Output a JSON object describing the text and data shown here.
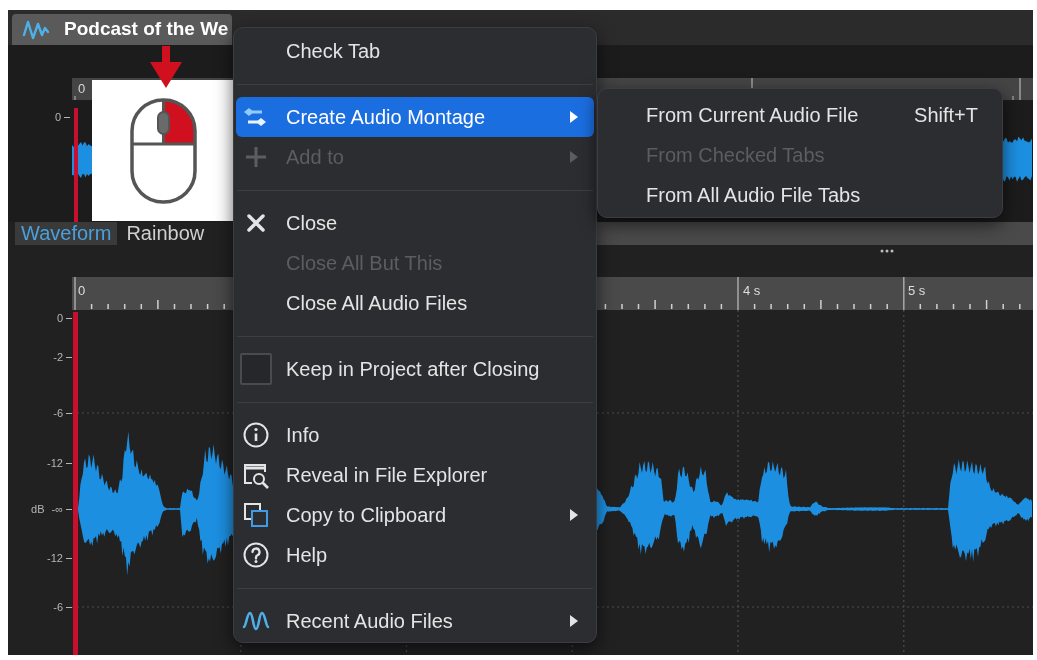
{
  "file_tabs": [
    {
      "title": "Podcast of the We",
      "selected": true
    }
  ],
  "overview": {
    "ruler_labels": [
      "0"
    ],
    "db_labels": [
      "0"
    ]
  },
  "view_tabs": [
    {
      "label": "Waveform",
      "selected": true
    },
    {
      "label": "Rainbow",
      "selected": false
    }
  ],
  "waveform_panel": {
    "ruler_labels": [
      "0",
      "4 s",
      "5 s"
    ],
    "db_unit": "dB",
    "db_labels": [
      "0",
      "-2",
      "-6",
      "-12",
      "-∞",
      "-12",
      "-6"
    ]
  },
  "context_menu": {
    "items": [
      {
        "kind": "item",
        "label": "Check Tab",
        "highlighted": false,
        "disabled": false,
        "has_submenu": false
      },
      {
        "kind": "separator"
      },
      {
        "kind": "item",
        "label": "Create Audio Montage",
        "highlighted": true,
        "disabled": false,
        "has_submenu": true
      },
      {
        "kind": "item",
        "label": "Add to",
        "highlighted": false,
        "disabled": true,
        "has_submenu": true
      },
      {
        "kind": "separator"
      },
      {
        "kind": "item",
        "label": "Close",
        "highlighted": false,
        "disabled": false,
        "has_submenu": false
      },
      {
        "kind": "item",
        "label": "Close All But This",
        "highlighted": false,
        "disabled": true,
        "has_submenu": false
      },
      {
        "kind": "item",
        "label": "Close All Audio Files",
        "highlighted": false,
        "disabled": false,
        "has_submenu": false
      },
      {
        "kind": "separator"
      },
      {
        "kind": "checkbox",
        "label": "Keep in Project after Closing",
        "checked": false,
        "highlighted": false,
        "disabled": false
      },
      {
        "kind": "separator"
      },
      {
        "kind": "item",
        "label": "Info",
        "highlighted": false,
        "disabled": false,
        "has_submenu": false
      },
      {
        "kind": "item",
        "label": "Reveal in File Explorer",
        "highlighted": false,
        "disabled": false,
        "has_submenu": false
      },
      {
        "kind": "item",
        "label": "Copy to Clipboard",
        "highlighted": false,
        "disabled": false,
        "has_submenu": true
      },
      {
        "kind": "item",
        "label": "Help",
        "highlighted": false,
        "disabled": false,
        "has_submenu": false
      },
      {
        "kind": "separator"
      },
      {
        "kind": "item",
        "label": "Recent Audio Files",
        "highlighted": false,
        "disabled": false,
        "has_submenu": true
      }
    ]
  },
  "submenu": {
    "items": [
      {
        "label": "From Current Audio File",
        "shortcut": "Shift+T",
        "disabled": false
      },
      {
        "label": "From Checked Tabs",
        "disabled": true
      },
      {
        "label": "From All Audio File Tabs",
        "disabled": false
      }
    ]
  }
}
